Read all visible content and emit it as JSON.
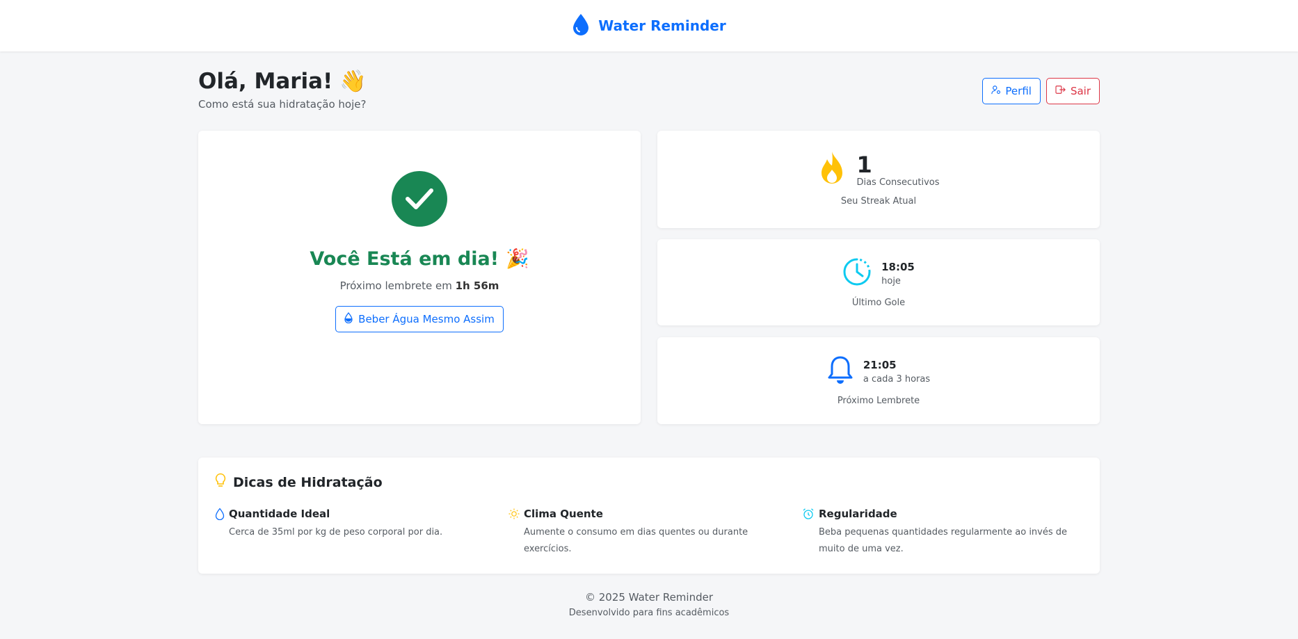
{
  "app": {
    "title": "Water Reminder"
  },
  "greeting": {
    "title": "Olá, Maria!",
    "emoji": "👋",
    "subtitle": "Como está sua hidratação hoje?"
  },
  "actions": {
    "profile_label": "Perfil",
    "logout_label": "Sair"
  },
  "status": {
    "title": "Você Está em dia!",
    "emoji": "🎉",
    "next_prefix": "Próximo lembrete em",
    "next_value": "1h 56m",
    "drink_label": "Beber Água Mesmo Assim"
  },
  "streak": {
    "value": "1",
    "unit": "Dias Consecutivos",
    "caption": "Seu Streak Atual"
  },
  "last_sip": {
    "time": "18:05",
    "when": "hoje",
    "caption": "Último Gole"
  },
  "next_reminder": {
    "time": "21:05",
    "interval": "a cada 3 horas",
    "caption": "Próximo Lembrete"
  },
  "tips": {
    "title": "Dicas de Hidratação",
    "items": [
      {
        "title": "Quantidade Ideal",
        "text": "Cerca de 35ml por kg de peso corporal por dia.",
        "icon": "droplet-icon"
      },
      {
        "title": "Clima Quente",
        "text": "Aumente o consumo em dias quentes ou durante exercícios.",
        "icon": "sun-icon"
      },
      {
        "title": "Regularidade",
        "text": "Beba pequenas quantidades regularmente ao invés de muito de uma vez.",
        "icon": "alarm-icon"
      }
    ]
  },
  "footer": {
    "copyright": "© 2025 Water Reminder",
    "note": "Desenvolvido para fins acadêmicos"
  },
  "colors": {
    "primary": "#0d6efd",
    "success": "#198754",
    "danger": "#dc3545",
    "warning": "#ffc107",
    "info": "#0dcaf0"
  }
}
